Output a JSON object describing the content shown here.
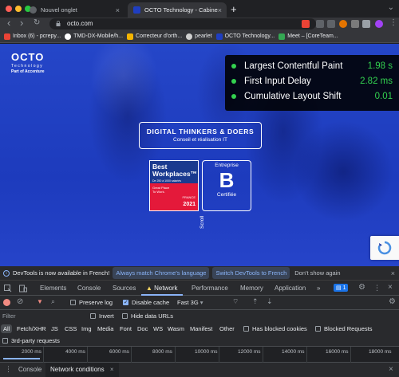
{
  "tabs": [
    {
      "title": "Nouvel onglet",
      "close": "×"
    },
    {
      "title": "OCTO Technology - Cabinet de",
      "close": "×"
    }
  ],
  "new_tab": "+",
  "tab_menu": "⌄",
  "nav": {
    "back": "‹",
    "forward": "›",
    "reload": "↻"
  },
  "address": {
    "url": "octo.com"
  },
  "bookmarks": [
    {
      "label": "Inbox (6) - pcrepy...",
      "color": "#ea4335"
    },
    {
      "label": "TMD-DX-Mobile/h...",
      "color": "#ffffff"
    },
    {
      "label": "Correcteur d'orth...",
      "color": "#f4b400"
    },
    {
      "label": "pearlet",
      "color": "#cfcfcf"
    },
    {
      "label": "OCTO Technology...",
      "color": "#1f3ec1"
    },
    {
      "label": "Meet – [CoreTeam...",
      "color": "#34a853"
    }
  ],
  "page": {
    "logo_main": "OCTO",
    "logo_sub1": "Technology",
    "logo_sub2": "Part of Accenture",
    "banner_title": "DIGITAL THINKERS & DOERS",
    "banner_sub": "Conseil et réalisation IT",
    "bestwp_title": "Best Workplaces™",
    "bestwp_sub": "De 250 à 1000 salariés",
    "bestwp_gp": "Great Place To Work.",
    "bestwp_country": "FRANCE",
    "bestwp_year": "2021",
    "bcorp_top": "Entreprise",
    "bcorp_letter": "B",
    "bcorp_bottom": "Certifiée",
    "scroll": "Scroll"
  },
  "metrics": [
    {
      "name": "Largest Contentful Paint",
      "value": "1.98 s"
    },
    {
      "name": "First Input Delay",
      "value": "2.82 ms"
    },
    {
      "name": "Cumulative Layout Shift",
      "value": "0.01"
    }
  ],
  "infobar": {
    "message": "DevTools is now available in French!",
    "btn1": "Always match Chrome's language",
    "btn2": "Switch DevTools to French",
    "dismiss": "Don't show again",
    "close": "×"
  },
  "devtools_tabs": [
    "Elements",
    "Console",
    "Sources",
    "Network",
    "Performance",
    "Memory",
    "Application",
    "»"
  ],
  "devtools_badge": "1",
  "network_toolbar": {
    "preserve_log": "Preserve log",
    "disable_cache": "Disable cache",
    "throttle": "Fast 3G",
    "throttle_arrow": "▾"
  },
  "filter": {
    "placeholder": "Filter",
    "invert": "Invert",
    "hide_data_urls": "Hide data URLs"
  },
  "types": [
    "All",
    "Fetch/XHR",
    "JS",
    "CSS",
    "Img",
    "Media",
    "Font",
    "Doc",
    "WS",
    "Wasm",
    "Manifest",
    "Other"
  ],
  "blocked_cookies": "Has blocked cookies",
  "blocked_requests": "Blocked Requests",
  "third_party": "3rd-party requests",
  "timeline_ticks": [
    "2000 ms",
    "4000 ms",
    "6000 ms",
    "8000 ms",
    "10000 ms",
    "12000 ms",
    "14000 ms",
    "16000 ms",
    "18000 ms"
  ],
  "drawer": {
    "tab1": "Console",
    "tab2": "Network conditions",
    "close": "×"
  },
  "colors": {
    "accent_green": "#33d14f",
    "octo_blue": "#1f3ec1",
    "devtools_accent": "#8ab4f8"
  }
}
